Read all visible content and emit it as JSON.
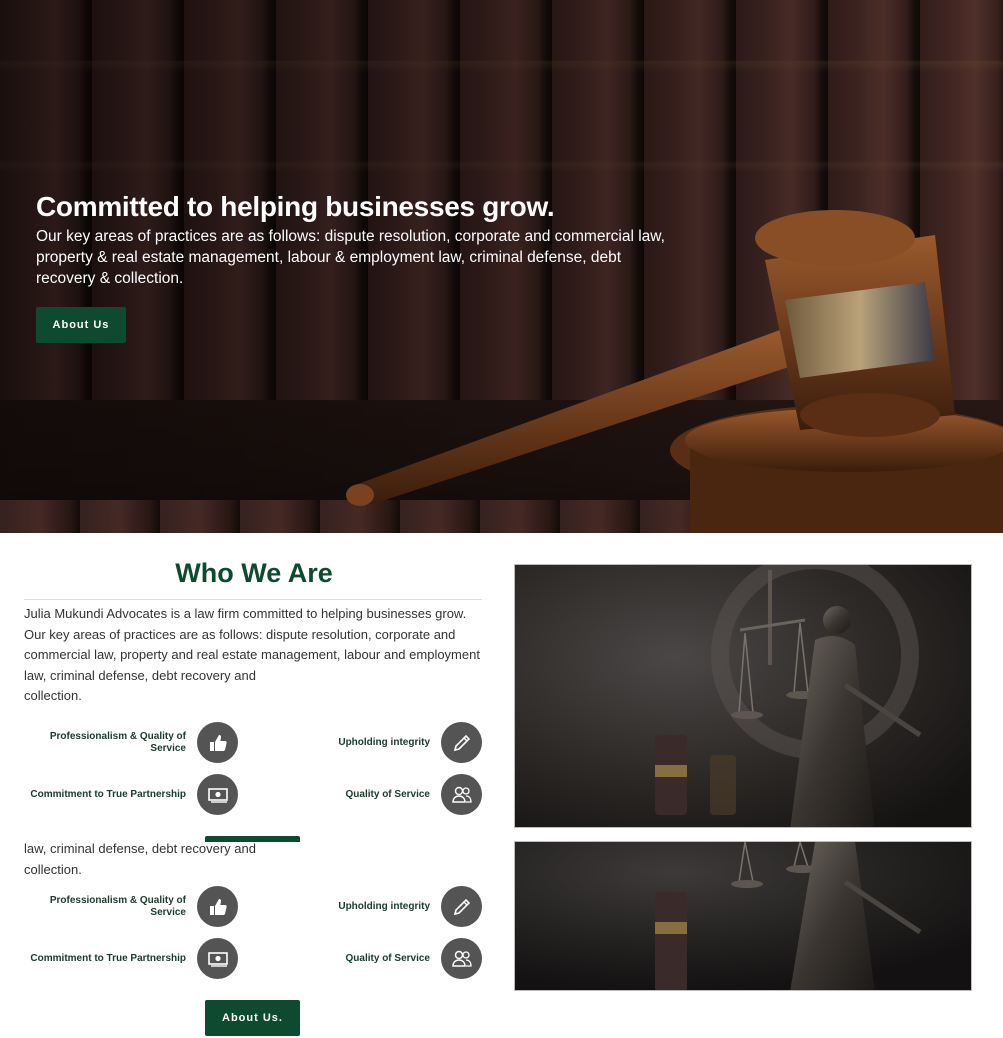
{
  "hero": {
    "title": "Committed to helping businesses grow.",
    "text": "Our key areas of practices are as follows: dispute resolution, corporate and commercial law, property & real estate management, labour & employment law, criminal defense, debt recovery & collection.",
    "button": "About Us",
    "background_icon": "gavel-on-bookshelf-image"
  },
  "who": {
    "title": "Who We Are",
    "paragraph": "Julia Mukundi Advocates is a law firm committed to helping businesses grow. Our key areas of practices are as follows: dispute resolution, corporate and commercial law, property and real estate management, labour and employment law, criminal defense, debt recovery and",
    "paragraph_end": "collection.",
    "features": [
      {
        "label": "Professionalism & Quality of Service",
        "icon": "thumbs-up-icon"
      },
      {
        "label": "Commitment to True Partnership",
        "icon": "money-icon"
      },
      {
        "label": "Upholding integrity",
        "icon": "pencil-icon"
      },
      {
        "label": "Quality of Service",
        "icon": "users-icon"
      }
    ]
  },
  "who_repeat": {
    "line1": "law, criminal defense, debt recovery and",
    "line2": "collection.",
    "button": "About Us."
  },
  "images": {
    "image1": "lady-justice-statue-image",
    "image2": "lady-justice-statue-image"
  },
  "colors": {
    "brand_green": "#0d4a30",
    "icon_circle": "#545454"
  }
}
